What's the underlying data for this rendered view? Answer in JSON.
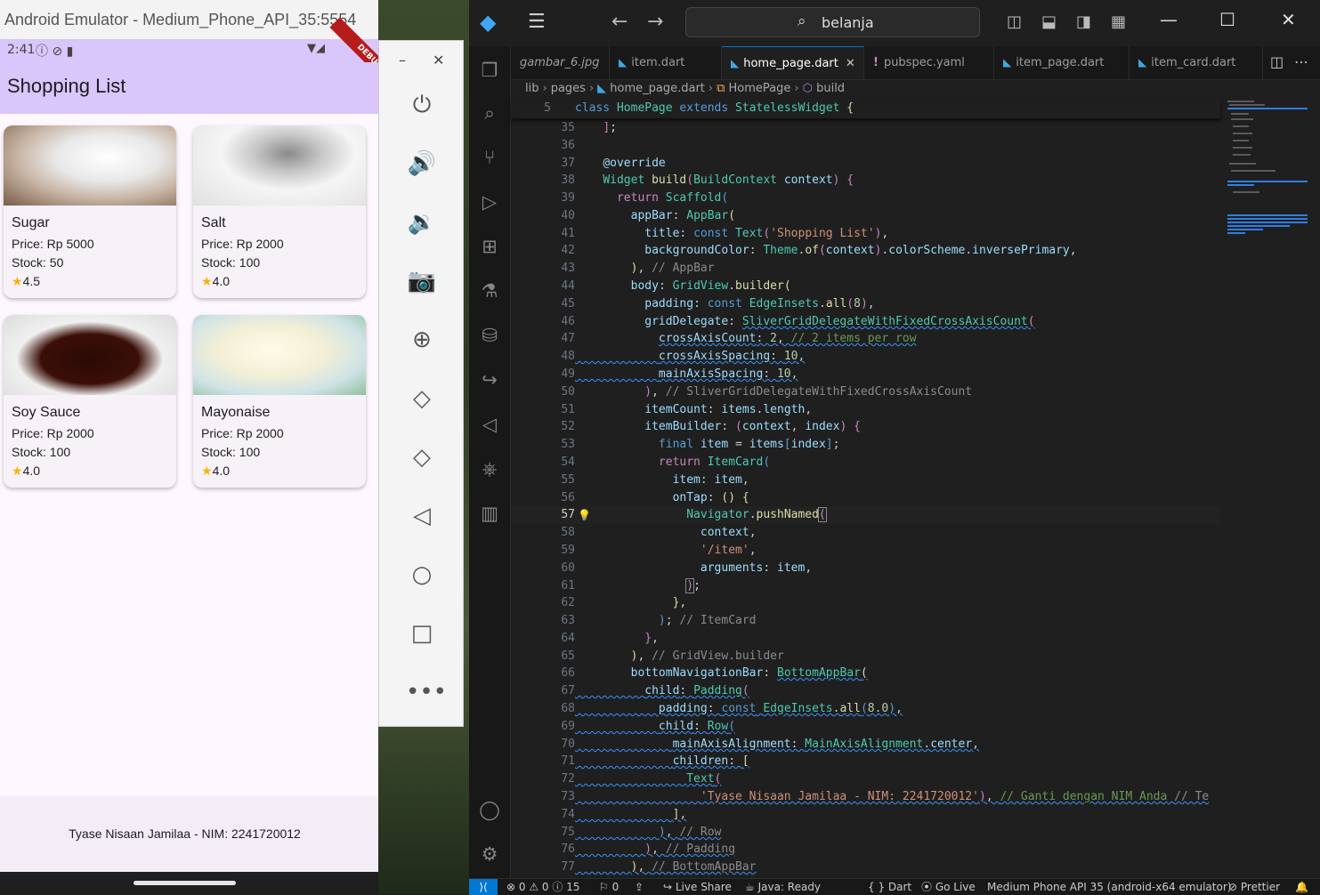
{
  "emulator": {
    "window_title": "Android Emulator - Medium_Phone_API_35:5554",
    "status_time": "2:41",
    "debug_banner": "DEBUG",
    "app_title": "Shopping List",
    "items": [
      {
        "name": "Sugar",
        "price": "Price: Rp 5000",
        "stock": "Stock: 50",
        "rating": "4.5"
      },
      {
        "name": "Salt",
        "price": "Price: Rp 2000",
        "stock": "Stock: 100",
        "rating": "4.0"
      },
      {
        "name": "Soy Sauce",
        "price": "Price: Rp 2000",
        "stock": "Stock: 100",
        "rating": "4.0"
      },
      {
        "name": "Mayonaise",
        "price": "Price: Rp 2000",
        "stock": "Stock: 100",
        "rating": "4.0"
      }
    ],
    "footer_text": "Tyase Nisaan Jamilaa - NIM: 2241720012",
    "toolbar": {
      "minimize": "–",
      "close": "✕"
    }
  },
  "vscode": {
    "search_text": "belanja",
    "tabs": [
      {
        "label": "gambar_6.jpg",
        "active": false
      },
      {
        "label": "item.dart",
        "active": false
      },
      {
        "label": "home_page.dart",
        "active": true
      },
      {
        "label": "pubspec.yaml",
        "active": false
      },
      {
        "label": "item_page.dart",
        "active": false
      },
      {
        "label": "item_card.dart",
        "active": false
      }
    ],
    "breadcrumb": [
      "lib",
      "pages",
      "home_page.dart",
      "HomePage",
      "build"
    ],
    "sticky_line_number": "5",
    "current_line": "57",
    "status": {
      "errors": "0",
      "warnings": "0",
      "info": "15",
      "ports": "0",
      "live_share": "Live Share",
      "java": "Java: Ready",
      "language": "Dart",
      "go_live": "Go Live",
      "device": "Medium Phone API 35 (android-x64 emulator)",
      "formatter": "Prettier"
    }
  }
}
